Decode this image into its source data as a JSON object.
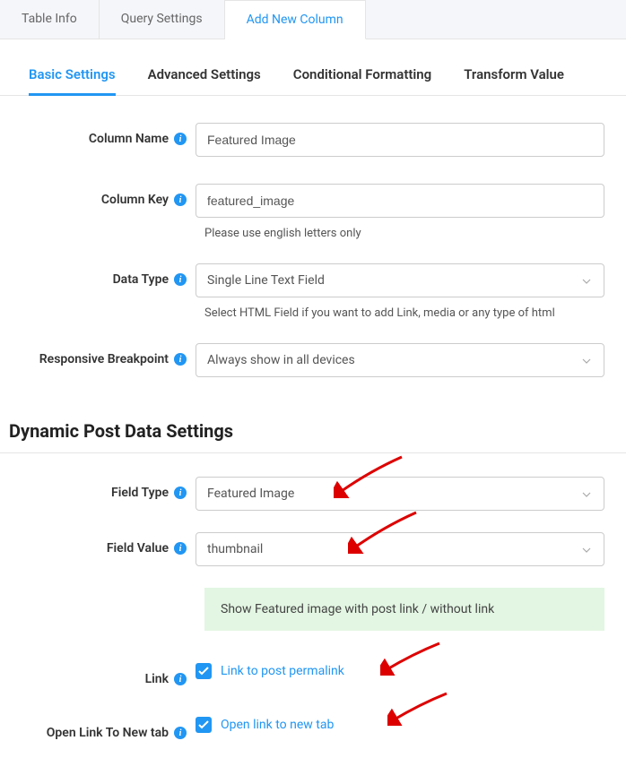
{
  "topTabs": {
    "tableInfo": "Table Info",
    "querySettings": "Query Settings",
    "addNewColumn": "Add New Column"
  },
  "subTabs": {
    "basic": "Basic Settings",
    "advanced": "Advanced Settings",
    "conditional": "Conditional Formatting",
    "transform": "Transform Value"
  },
  "columnName": {
    "label": "Column Name",
    "value": "Featured Image"
  },
  "columnKey": {
    "label": "Column Key",
    "value": "featured_image",
    "helper": "Please use english letters only"
  },
  "dataType": {
    "label": "Data Type",
    "value": "Single Line Text Field",
    "helper": "Select HTML Field if you want to add Link, media or any type of html"
  },
  "responsive": {
    "label": "Responsive Breakpoint",
    "value": "Always show in all devices"
  },
  "dynamicHeading": "Dynamic Post Data Settings",
  "fieldType": {
    "label": "Field Type",
    "value": "Featured Image"
  },
  "fieldValue": {
    "label": "Field Value",
    "value": "thumbnail"
  },
  "notice": "Show Featured image with post link / without link",
  "link": {
    "label": "Link",
    "checkbox": "Link to post permalink"
  },
  "newTab": {
    "label": "Open Link To New tab",
    "checkbox": "Open link to new tab"
  }
}
